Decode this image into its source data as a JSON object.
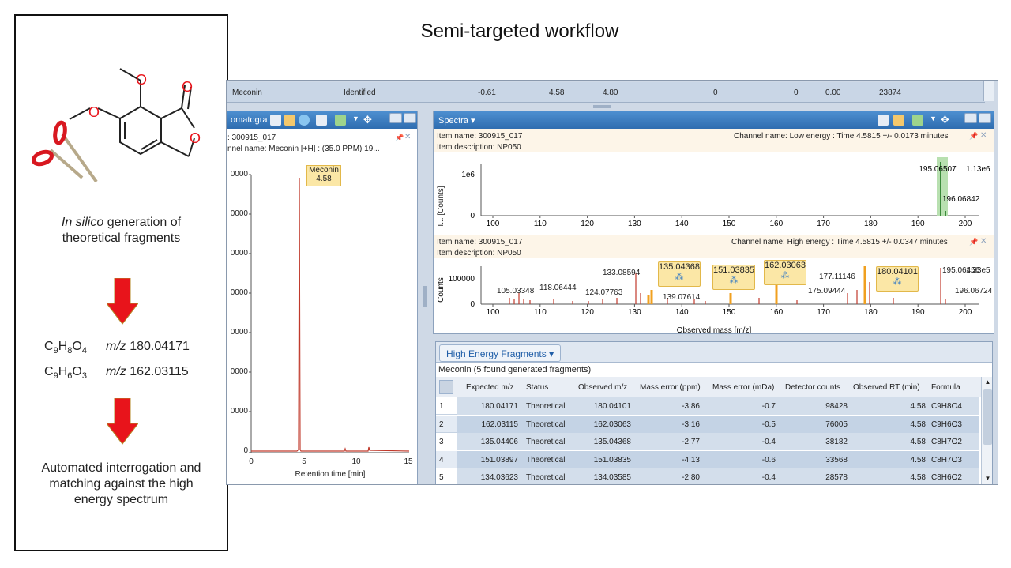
{
  "slide": {
    "title": "Semi-targeted workflow"
  },
  "left_panel": {
    "structure_atoms": {
      "o1": "O",
      "o2": "O",
      "o3": "O",
      "o4": "O"
    },
    "step1_italic": "In silico",
    "step1_rest": "generation of",
    "step1_line2": "theoretical fragments",
    "formula1": {
      "c": "C",
      "c_sub": "9",
      "h": "H",
      "h_sub": "8",
      "o": "O",
      "o_sub": "4",
      "mz_label": "m/z",
      "mz": "180.04171"
    },
    "formula2": {
      "c": "C",
      "c_sub": "9",
      "h": "H",
      "h_sub": "6",
      "o": "O",
      "o_sub": "3",
      "mz_label": "m/z",
      "mz": "162.03115"
    },
    "step2_line1": "Automated interrogation and",
    "step2_line2": "matching against the high",
    "step2_line3": "energy spectrum",
    "arrow_color": "#e8141b"
  },
  "app": {
    "top_row": {
      "name": "Meconin",
      "status": "Identified",
      "v1": "-0.61",
      "v2": "4.58",
      "v3": "4.80",
      "v4": "0",
      "v5": "0",
      "v6": "0.00",
      "v7": "23874"
    },
    "chrom_panel": {
      "title": "omatogra",
      "item_name": ": 300915_017",
      "channel": "nnel name: Meconin [+H] : (35.0 PPM) 19...",
      "peak_name": "Meconin",
      "peak_rt": "4.58",
      "x_ticks": [
        "0",
        "5",
        "10",
        "15"
      ],
      "y_ticks": [
        "0000",
        "0000",
        "0000",
        "0000",
        "0000",
        "0000",
        "0000",
        "0"
      ],
      "x_label": "Retention time [min]"
    },
    "spectra_panel": {
      "title": "Spectra",
      "low": {
        "item_name": "Item name: 300915_017",
        "item_desc": "Item description: NP050",
        "channel": "Channel name: Low energy : Time 4.5815 +/- 0.0173 minutes",
        "y_label": "I... [Counts]",
        "y_tick": "1e6",
        "y_zero": "0",
        "max_label": "1.13e6",
        "peaks": [
          {
            "mz": "195.06507",
            "rel": 1.0
          },
          {
            "mz": "196.06842",
            "rel": 0.07
          }
        ],
        "x_ticks": [
          "100",
          "110",
          "120",
          "130",
          "140",
          "150",
          "160",
          "170",
          "180",
          "190",
          "200"
        ]
      },
      "high": {
        "item_name": "Item name: 300915_017",
        "item_desc": "Item description: NP050",
        "channel": "Channel name: High energy : Time 4.5815 +/- 0.0347 minutes",
        "y_label": "Counts",
        "y_tick": "100000",
        "y_zero": "0",
        "max_label": "1.33e5",
        "labels": [
          "105.03348",
          "118.06444",
          "124.07763",
          "133.08594",
          "139.07614",
          "175.09444",
          "177.11146",
          "195.06456",
          "196.06724"
        ],
        "fragments": [
          "135.04368",
          "151.03835",
          "162.03063",
          "180.04101"
        ],
        "x_ticks": [
          "100",
          "110",
          "120",
          "130",
          "140",
          "150",
          "160",
          "170",
          "180",
          "190",
          "200"
        ],
        "x_label": "Observed mass [m/z]"
      }
    },
    "fragments_panel": {
      "tab": "High Energy Fragments",
      "summary": "Meconin (5 found generated fragments)",
      "columns": [
        "Expected m/z",
        "Status",
        "Observed m/z",
        "Mass error (ppm)",
        "Mass error (mDa)",
        "Detector counts",
        "Observed RT (min)",
        "Formula"
      ],
      "rows": [
        {
          "n": "1",
          "expected": "180.04171",
          "status": "Theoretical",
          "observed": "180.04101",
          "ppm": "-3.86",
          "mda": "-0.7",
          "counts": "98428",
          "rt": "4.58",
          "formula": "C9H8O4"
        },
        {
          "n": "2",
          "expected": "162.03115",
          "status": "Theoretical",
          "observed": "162.03063",
          "ppm": "-3.16",
          "mda": "-0.5",
          "counts": "76005",
          "rt": "4.58",
          "formula": "C9H6O3"
        },
        {
          "n": "3",
          "expected": "135.04406",
          "status": "Theoretical",
          "observed": "135.04368",
          "ppm": "-2.77",
          "mda": "-0.4",
          "counts": "38182",
          "rt": "4.58",
          "formula": "C8H7O2"
        },
        {
          "n": "4",
          "expected": "151.03897",
          "status": "Theoretical",
          "observed": "151.03835",
          "ppm": "-4.13",
          "mda": "-0.6",
          "counts": "33568",
          "rt": "4.58",
          "formula": "C8H7O3"
        },
        {
          "n": "5",
          "expected": "134.03623",
          "status": "Theoretical",
          "observed": "134.03585",
          "ppm": "-2.80",
          "mda": "-0.4",
          "counts": "28578",
          "rt": "4.58",
          "formula": "C8H6O2"
        }
      ]
    }
  }
}
